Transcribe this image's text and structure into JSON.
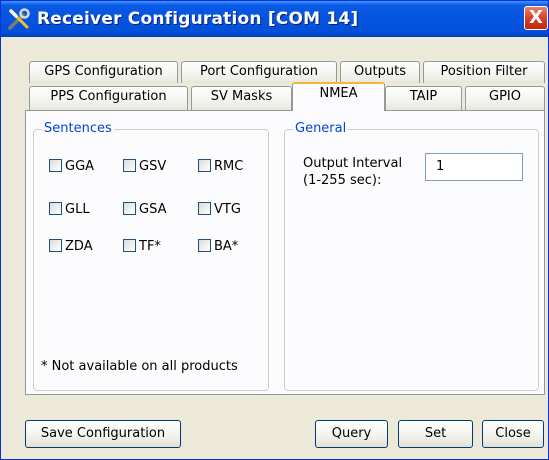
{
  "window": {
    "title": "Receiver Configuration [COM 14]",
    "close_glyph": "X",
    "icon": "tools-icon"
  },
  "tabs": {
    "row1": [
      {
        "label": "GPS Configuration"
      },
      {
        "label": "Port Configuration"
      },
      {
        "label": "Outputs"
      },
      {
        "label": "Position Filter"
      }
    ],
    "row2": [
      {
        "label": "PPS Configuration"
      },
      {
        "label": "SV Masks"
      },
      {
        "label": "NMEA",
        "active": true
      },
      {
        "label": "TAIP"
      },
      {
        "label": "GPIO"
      }
    ]
  },
  "sentences": {
    "legend": "Sentences",
    "items": [
      {
        "label": "GGA",
        "checked": false
      },
      {
        "label": "GSV",
        "checked": false
      },
      {
        "label": "RMC",
        "checked": false
      },
      {
        "label": "GLL",
        "checked": false
      },
      {
        "label": "GSA",
        "checked": false
      },
      {
        "label": "VTG",
        "checked": false
      },
      {
        "label": "ZDA",
        "checked": false
      },
      {
        "label": "TF*",
        "checked": false
      },
      {
        "label": "BA*",
        "checked": false
      }
    ],
    "footnote": "* Not available on all products"
  },
  "general": {
    "legend": "General",
    "output_interval_label_1": "Output Interval",
    "output_interval_label_2": "(1-255 sec):",
    "output_interval_value": "1"
  },
  "buttons": {
    "save": "Save Configuration",
    "query": "Query",
    "set": "Set",
    "close": "Close"
  },
  "colors": {
    "titlebar": "#0454e0",
    "dialog_bg": "#ece9d8",
    "group_legend": "#0046d5",
    "active_tab_accent": "#f5b53e"
  }
}
